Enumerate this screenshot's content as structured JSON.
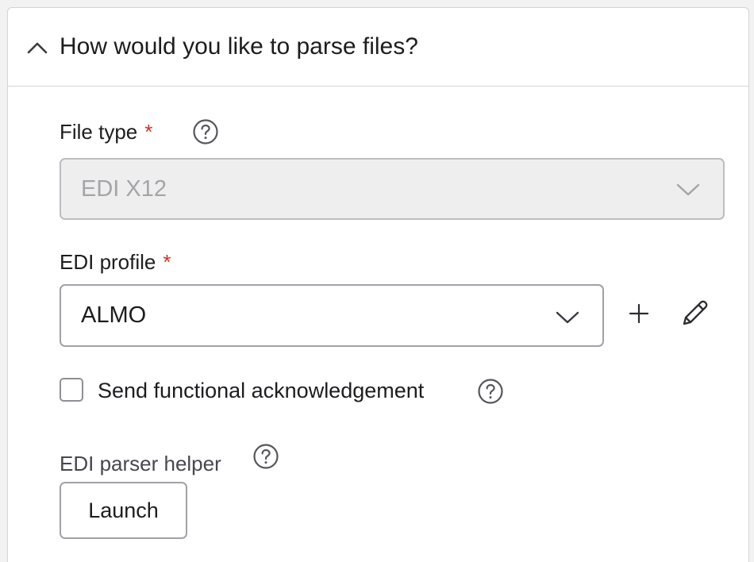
{
  "section": {
    "title": "How would you like to parse files?",
    "collapse_icon": "chevron-up-icon"
  },
  "file_type": {
    "label": "File type",
    "required_marker": "*",
    "help_icon": "question-circle-icon",
    "value": "EDI X12",
    "disabled": true,
    "dropdown_icon": "chevron-down-icon"
  },
  "edi_profile": {
    "label": "EDI profile",
    "required_marker": "*",
    "value": "ALMO",
    "dropdown_icon": "chevron-down-icon",
    "add_icon": "plus-icon",
    "edit_icon": "pencil-icon"
  },
  "functional_ack": {
    "label": "Send functional acknowledgement",
    "checked": false,
    "help_icon": "question-circle-icon"
  },
  "parser_helper": {
    "label": "EDI parser helper",
    "help_icon": "question-circle-icon",
    "button_label": "Launch"
  },
  "colors": {
    "required": "#d92d20",
    "border": "#a1a1a8",
    "disabled_bg": "#eeeeee",
    "disabled_text": "#a4a4a9",
    "text": "#1d1d20",
    "page_bg": "#f2f2f3"
  }
}
